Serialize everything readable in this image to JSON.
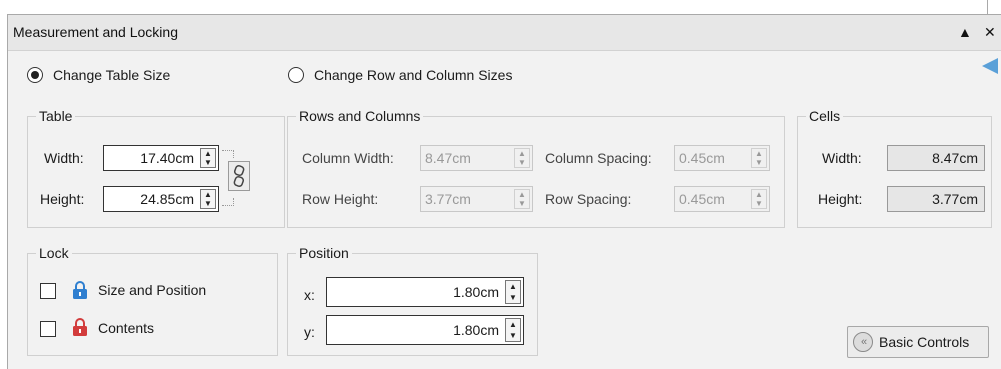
{
  "panel": {
    "title": "Measurement and Locking",
    "collapse_glyph": "▲",
    "close_glyph": "✕"
  },
  "mode": {
    "change_table_size": {
      "label": "Change Table Size",
      "checked": true
    },
    "change_row_col_sizes": {
      "label": "Change Row and Column Sizes",
      "checked": false
    }
  },
  "table": {
    "group_label": "Table",
    "width_label": "Width:",
    "width_value": "17.40cm",
    "height_label": "Height:",
    "height_value": "24.85cm"
  },
  "rows_columns": {
    "group_label": "Rows and Columns",
    "column_width_label": "Column Width:",
    "column_width_value": "8.47cm",
    "column_spacing_label": "Column Spacing:",
    "column_spacing_value": "0.45cm",
    "row_height_label": "Row Height:",
    "row_height_value": "3.77cm",
    "row_spacing_label": "Row Spacing:",
    "row_spacing_value": "0.45cm"
  },
  "cells": {
    "group_label": "Cells",
    "width_label": "Width:",
    "width_value": "8.47cm",
    "height_label": "Height:",
    "height_value": "3.77cm"
  },
  "lock": {
    "group_label": "Lock",
    "size_position_label": "Size and Position",
    "size_position_checked": false,
    "contents_label": "Contents",
    "contents_checked": false
  },
  "position": {
    "group_label": "Position",
    "x_label": "x:",
    "x_value": "1.80cm",
    "y_label": "y:",
    "y_value": "1.80cm"
  },
  "basic_controls": {
    "label": "Basic Controls",
    "icon_glyph": "«"
  },
  "colors": {
    "accent_arrow": "#5aa0d8",
    "lock_blue": "#2f7fd0",
    "lock_red": "#d23c3c"
  }
}
